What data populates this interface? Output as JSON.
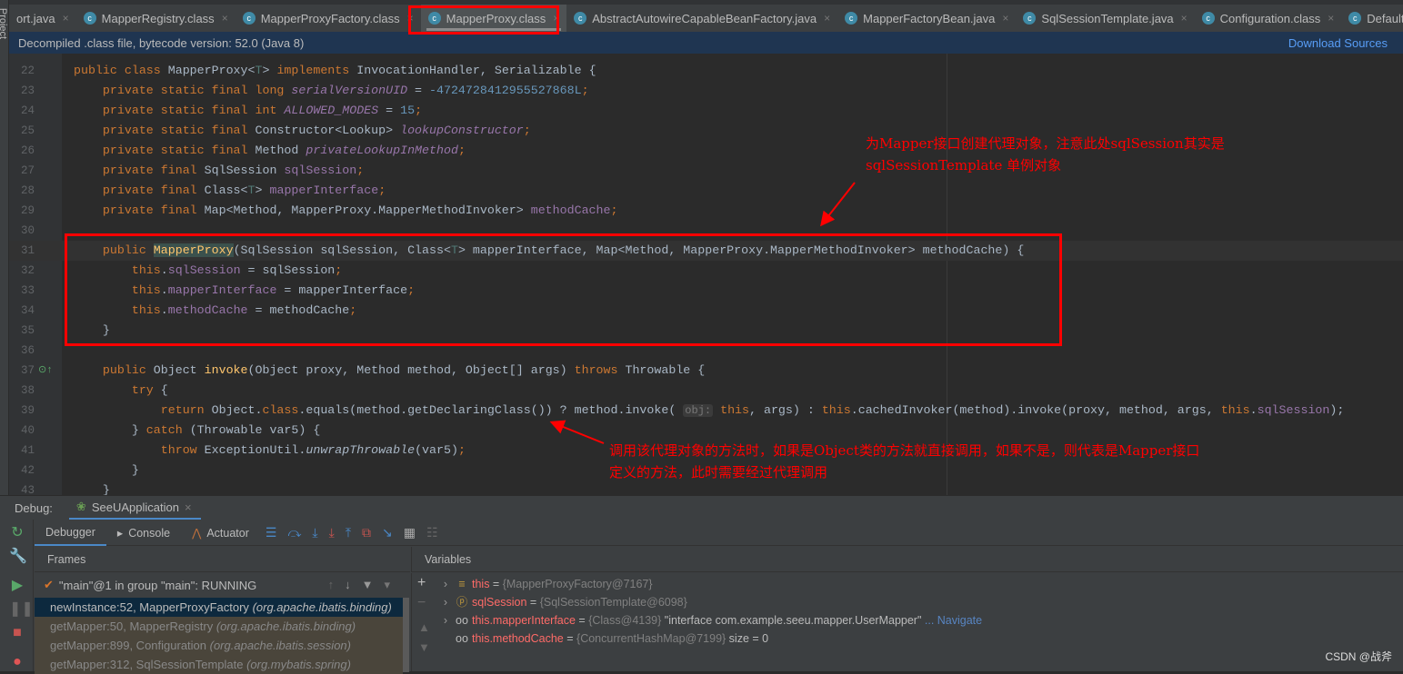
{
  "sidebar": {
    "project_label": "Project"
  },
  "tabs": [
    {
      "label": "ort.java",
      "icon": "java-file-icon"
    },
    {
      "label": "MapperRegistry.class",
      "icon": "class-file-icon"
    },
    {
      "label": "MapperProxyFactory.class",
      "icon": "class-file-icon"
    },
    {
      "label": "MapperProxy.class",
      "icon": "class-file-icon",
      "active": true
    },
    {
      "label": "AbstractAutowireCapableBeanFactory.java",
      "icon": "class-file-icon"
    },
    {
      "label": "MapperFactoryBean.java",
      "icon": "class-file-icon"
    },
    {
      "label": "SqlSessionTemplate.java",
      "icon": "class-file-icon"
    },
    {
      "label": "Configuration.class",
      "icon": "class-file-icon"
    },
    {
      "label": "DefaultSqlS",
      "icon": "class-file-icon"
    }
  ],
  "banner": {
    "text": "Decompiled .class file, bytecode version: 52.0 (Java 8)",
    "action": "Download Sources"
  },
  "code": [
    {
      "n": "22",
      "t": [
        [
          "public class ",
          "k"
        ],
        [
          "MapperProxy<",
          "d"
        ],
        [
          "T",
          "tp"
        ],
        [
          "> ",
          "d"
        ],
        [
          "implements ",
          "k"
        ],
        [
          "InvocationHandler, Serializable {",
          "d"
        ]
      ]
    },
    {
      "n": "23",
      "t": [
        [
          "    private static final long ",
          "k"
        ],
        [
          "serialVersionUID",
          "fi"
        ],
        [
          " = ",
          "d"
        ],
        [
          "-4724728412955527868L",
          "n"
        ],
        [
          ";",
          "k"
        ]
      ]
    },
    {
      "n": "24",
      "t": [
        [
          "    private static final int ",
          "k"
        ],
        [
          "ALLOWED_MODES",
          "fi"
        ],
        [
          " = ",
          "d"
        ],
        [
          "15",
          "n"
        ],
        [
          ";",
          "k"
        ]
      ]
    },
    {
      "n": "25",
      "t": [
        [
          "    private static final ",
          "k"
        ],
        [
          "Constructor<Lookup> ",
          "d"
        ],
        [
          "lookupConstructor",
          "fi"
        ],
        [
          ";",
          "k"
        ]
      ]
    },
    {
      "n": "26",
      "t": [
        [
          "    private static final ",
          "k"
        ],
        [
          "Method ",
          "d"
        ],
        [
          "privateLookupInMethod",
          "fi"
        ],
        [
          ";",
          "k"
        ]
      ]
    },
    {
      "n": "27",
      "t": [
        [
          "    private final ",
          "k"
        ],
        [
          "SqlSession ",
          "d"
        ],
        [
          "sqlSession",
          "f"
        ],
        [
          ";",
          "k"
        ]
      ]
    },
    {
      "n": "28",
      "t": [
        [
          "    private final ",
          "k"
        ],
        [
          "Class<",
          "d"
        ],
        [
          "T",
          "tp"
        ],
        [
          "> ",
          "d"
        ],
        [
          "mapperInterface",
          "f"
        ],
        [
          ";",
          "k"
        ]
      ]
    },
    {
      "n": "29",
      "t": [
        [
          "    private final ",
          "k"
        ],
        [
          "Map<Method, MapperProxy.MapperMethodInvoker> ",
          "d"
        ],
        [
          "methodCache",
          "f"
        ],
        [
          ";",
          "k"
        ]
      ]
    },
    {
      "n": "30",
      "t": []
    },
    {
      "n": "31",
      "caret": true,
      "t": [
        [
          "    public ",
          "k"
        ],
        [
          "MapperProxy",
          "mh"
        ],
        [
          "(SqlSession sqlSession, Class<",
          "d"
        ],
        [
          "T",
          "tp"
        ],
        [
          "> mapperInterface, Map<Method, MapperProxy.MapperMethodInvoker> methodCache) {",
          "d"
        ]
      ]
    },
    {
      "n": "32",
      "t": [
        [
          "        this",
          "k"
        ],
        [
          ".",
          "d"
        ],
        [
          "sqlSession",
          "f"
        ],
        [
          " = sqlSession",
          "d"
        ],
        [
          ";",
          "k"
        ]
      ]
    },
    {
      "n": "33",
      "t": [
        [
          "        this",
          "k"
        ],
        [
          ".",
          "d"
        ],
        [
          "mapperInterface",
          "f"
        ],
        [
          " = mapperInterface",
          "d"
        ],
        [
          ";",
          "k"
        ]
      ]
    },
    {
      "n": "34",
      "t": [
        [
          "        this",
          "k"
        ],
        [
          ".",
          "d"
        ],
        [
          "methodCache",
          "f"
        ],
        [
          " = methodCache",
          "d"
        ],
        [
          ";",
          "k"
        ]
      ]
    },
    {
      "n": "35",
      "t": [
        [
          "    }",
          "d"
        ]
      ]
    },
    {
      "n": "36",
      "t": []
    },
    {
      "n": "37",
      "t": [
        [
          "    public ",
          "k"
        ],
        [
          "Object ",
          "d"
        ],
        [
          "invoke",
          "m"
        ],
        [
          "(Object proxy, Method method, Object[] args) ",
          "d"
        ],
        [
          "throws ",
          "k"
        ],
        [
          "Throwable {",
          "d"
        ]
      ]
    },
    {
      "n": "38",
      "t": [
        [
          "        try ",
          "k"
        ],
        [
          "{",
          "d"
        ]
      ]
    },
    {
      "n": "39",
      "t": [
        [
          "            return ",
          "k"
        ],
        [
          "Object.",
          "d"
        ],
        [
          "class",
          "k"
        ],
        [
          ".equals(method.getDeclaringClass()) ? method.invoke( ",
          "d"
        ],
        [
          "obj:",
          "hint"
        ],
        [
          " this",
          "k"
        ],
        [
          ", args) : ",
          "d"
        ],
        [
          "this",
          "k"
        ],
        [
          ".cachedInvoker(method).invoke(proxy, method, args, ",
          "d"
        ],
        [
          "this",
          "k"
        ],
        [
          ".",
          "d"
        ],
        [
          "sqlSession",
          "f"
        ],
        [
          ");",
          "d"
        ]
      ]
    },
    {
      "n": "40",
      "t": [
        [
          "        } ",
          "d"
        ],
        [
          "catch ",
          "k"
        ],
        [
          "(Throwable var5) {",
          "d"
        ]
      ]
    },
    {
      "n": "41",
      "t": [
        [
          "            throw ",
          "k"
        ],
        [
          "ExceptionUtil.",
          "d"
        ],
        [
          "unwrapThrowable",
          "it"
        ],
        [
          "(var5)",
          "d"
        ],
        [
          ";",
          "k"
        ]
      ]
    },
    {
      "n": "42",
      "t": [
        [
          "        }",
          "d"
        ]
      ]
    },
    {
      "n": "43",
      "t": [
        [
          "    }",
          "d"
        ]
      ]
    }
  ],
  "annotations": {
    "note1_line1": "为Mapper接口创建代理对象，注意此处sqlSession其实是",
    "note1_line2": "sqlSessionTemplate 单例对象",
    "note2_line1": "调用该代理对象的方法时，如果是Object类的方法就直接调用，如果不是，则代表是Mapper接口",
    "note2_line2": "定义的方法，此时需要经过代理调用",
    "color": "#ff0000"
  },
  "debug": {
    "label": "Debug:",
    "session": "SeeUApplication",
    "tabs": {
      "debugger": "Debugger",
      "console": "Console",
      "actuator": "Actuator"
    },
    "frames_title": "Frames",
    "variables_title": "Variables",
    "thread": "\"main\"@1 in group \"main\": RUNNING",
    "frames": [
      {
        "method": "newInstance:52, MapperProxyFactory ",
        "pkg": "(org.apache.ibatis.binding)",
        "selected": true
      },
      {
        "method": "getMapper:50, MapperRegistry ",
        "pkg": "(org.apache.ibatis.binding)"
      },
      {
        "method": "getMapper:899, Configuration ",
        "pkg": "(org.apache.ibatis.session)"
      },
      {
        "method": "getMapper:312, SqlSessionTemplate ",
        "pkg": "(org.mybatis.spring)"
      }
    ],
    "variables": [
      {
        "name": "this",
        "eq": " = ",
        "value": "{MapperProxyFactory@7167}",
        "icon": "object-icon",
        "expandable": true
      },
      {
        "name": "sqlSession",
        "eq": " = ",
        "value": "{SqlSessionTemplate@6098}",
        "icon": "parameter-icon",
        "expandable": true
      },
      {
        "name": "this.mapperInterface",
        "eq": " = ",
        "value": "{Class@4139} ",
        "string": "\"interface com.example.seeu.mapper.UserMapper\"",
        "link": " ... Navigate",
        "icon": "watch-icon",
        "expandable": true
      },
      {
        "name": "this.methodCache",
        "eq": " = ",
        "value": "{ConcurrentHashMap@7199} ",
        "string": " size = 0",
        "icon": "watch-icon",
        "expandable": false
      }
    ]
  },
  "watermark": "CSDN @战斧"
}
